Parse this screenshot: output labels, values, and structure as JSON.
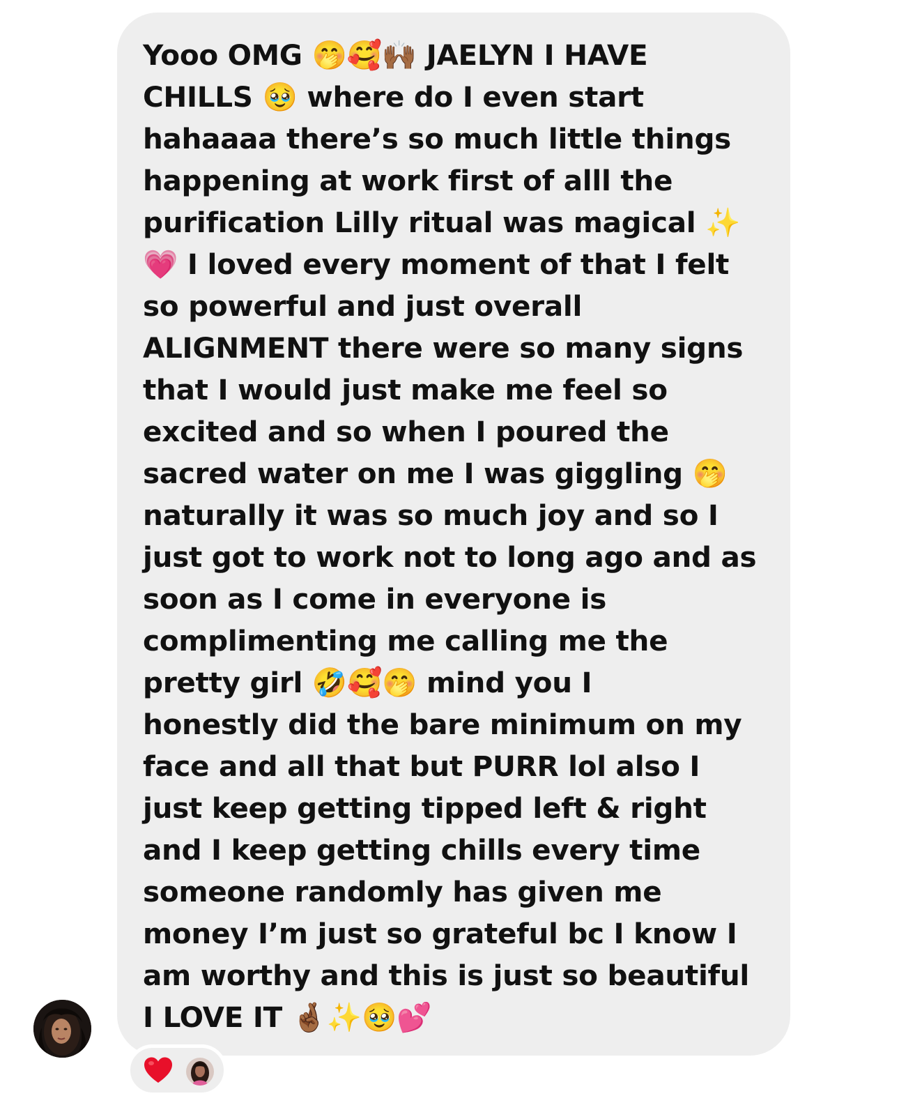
{
  "message": {
    "lines": [
      "Yooo OMG 🤭🥰🙌🏾 JAELYN I HAVE",
      "CHILLS 🥹 where do I even start",
      "hahaaaa there’s so much little things",
      "happening at work first of alll the",
      "purification Lilly ritual was magical ✨",
      "💗 I loved every moment of that I felt",
      "so powerful and just overall",
      "ALIGNMENT there were so many signs",
      "that I would just make me feel so",
      "excited and so when I poured the",
      "sacred water on me I was giggling 🤭",
      "naturally it was so much joy and so I",
      "just got to work not to long ago and as",
      "soon as I come in everyone is",
      "complimenting me calling me the",
      "pretty girl 🤣🥰🤭 mind you I",
      "honestly did the bare minimum on my",
      "face and all that but PURR lol also I",
      "just keep getting tipped left & right",
      "and I keep getting chills every time",
      "someone randomly has given me",
      "money I’m just so grateful bc I know I",
      "am worthy and this is just so beautiful",
      "I LOVE IT 🤞🏾✨🥹💕"
    ],
    "bubble_color": "#eeeeee",
    "text_color": "#111111"
  },
  "sender": {
    "avatar_icon": "profile-photo-avatar"
  },
  "reaction": {
    "emoji_icon": "red-heart-icon",
    "heart_color": "#e8102a",
    "reactor_avatar_icon": "reactor-profile-photo"
  }
}
